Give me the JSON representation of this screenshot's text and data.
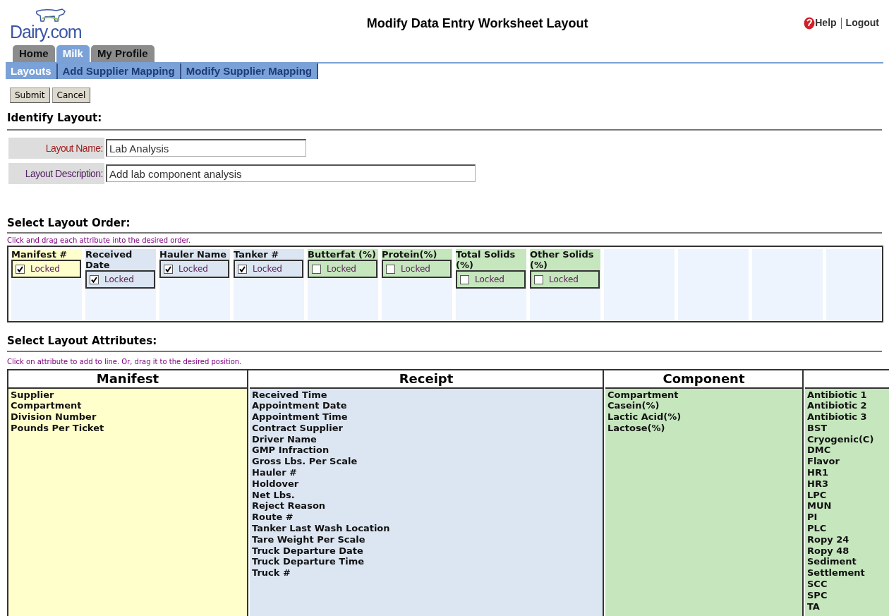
{
  "header": {
    "logo": "Dairy.com",
    "title": "Modify Data Entry Worksheet Layout",
    "links": [
      "Help",
      "Logout"
    ]
  },
  "tabs": [
    {
      "label": "Home",
      "selected": false
    },
    {
      "label": "Milk",
      "selected": true
    },
    {
      "label": "My Profile",
      "selected": false
    }
  ],
  "subnav": [
    {
      "label": "Layouts",
      "selected": true
    },
    {
      "label": "Add Supplier Mapping",
      "selected": false
    },
    {
      "label": "Modify Supplier Mapping",
      "selected": false
    }
  ],
  "buttons": [
    "Submit",
    "Cancel"
  ],
  "identify": {
    "heading": "Identify Layout:",
    "fields": [
      {
        "label": "Layout Name:",
        "value": "Lab Analysis",
        "required": true
      },
      {
        "label": "Layout Description:",
        "value": "Add lab component analysis",
        "required": false
      }
    ]
  },
  "order": {
    "heading": "Select Layout Order:",
    "hint": "Click and drag each attribute into the desired order.",
    "slots": [
      {
        "label": "Manifest #",
        "color": "#ffffcc",
        "locked": true,
        "lock_label": "Locked"
      },
      {
        "label": "Received Date",
        "color": "#dce6f2",
        "locked": true,
        "lock_label": "Locked"
      },
      {
        "label": "Hauler Name",
        "color": "#dce6f2",
        "locked": true,
        "lock_label": "Locked"
      },
      {
        "label": "Tanker #",
        "color": "#dce6f2",
        "locked": true,
        "lock_label": "Locked"
      },
      {
        "label": "Butterfat (%)",
        "color": "#c6e6be",
        "locked": false,
        "lock_label": "Locked"
      },
      {
        "label": "Protein(%)",
        "color": "#c6e6be",
        "locked": false,
        "lock_label": "Locked"
      },
      {
        "label": "Total Solids (%)",
        "color": "#c6e6be",
        "locked": false,
        "lock_label": "Locked"
      },
      {
        "label": "Other Solids (%)",
        "color": "#c6e6be",
        "locked": false,
        "lock_label": "Locked"
      }
    ]
  },
  "attributes": {
    "heading": "Select Layout Attributes:",
    "hint": "Click on attribute to add to line. Or, drag it to the desired position.",
    "columns": [
      {
        "title": "Manifest",
        "color": "#ffffcc",
        "items": [
          "Supplier",
          "Compartment",
          "Division Number",
          "Pounds Per Ticket"
        ]
      },
      {
        "title": "Receipt",
        "color": "#dce6f2",
        "items": [
          "Received Time",
          "Appointment Date",
          "Appointment Time",
          "Contract Supplier",
          "Driver Name",
          "GMP Infraction",
          "Gross Lbs. Per Scale",
          "Hauler #",
          "Holdover",
          "Net Lbs.",
          "Reject Reason",
          "Route #",
          "Tanker Last Wash Location",
          "Tare Weight Per Scale",
          "Truck Departure Date",
          "Truck Departure Time",
          "Truck #"
        ]
      },
      {
        "title": "Component",
        "color": "#c6e6be",
        "items": [
          "Compartment",
          "Casein(%)",
          "Lactic Acid(%)",
          "Lactose(%)"
        ]
      },
      {
        "color": "#c6e6be",
        "items": [
          "Antibiotic 1",
          "Antibiotic 2",
          "Antibiotic 3",
          "BST",
          "Cryogenic(C)",
          "DMC",
          "Flavor",
          "HR1",
          "HR3",
          "LPC",
          "MUN",
          "PI",
          "PLC",
          "Ropy 24",
          "Ropy 48",
          "Sediment",
          "Settlement",
          "SCC",
          "SPC",
          "TA"
        ]
      }
    ]
  }
}
